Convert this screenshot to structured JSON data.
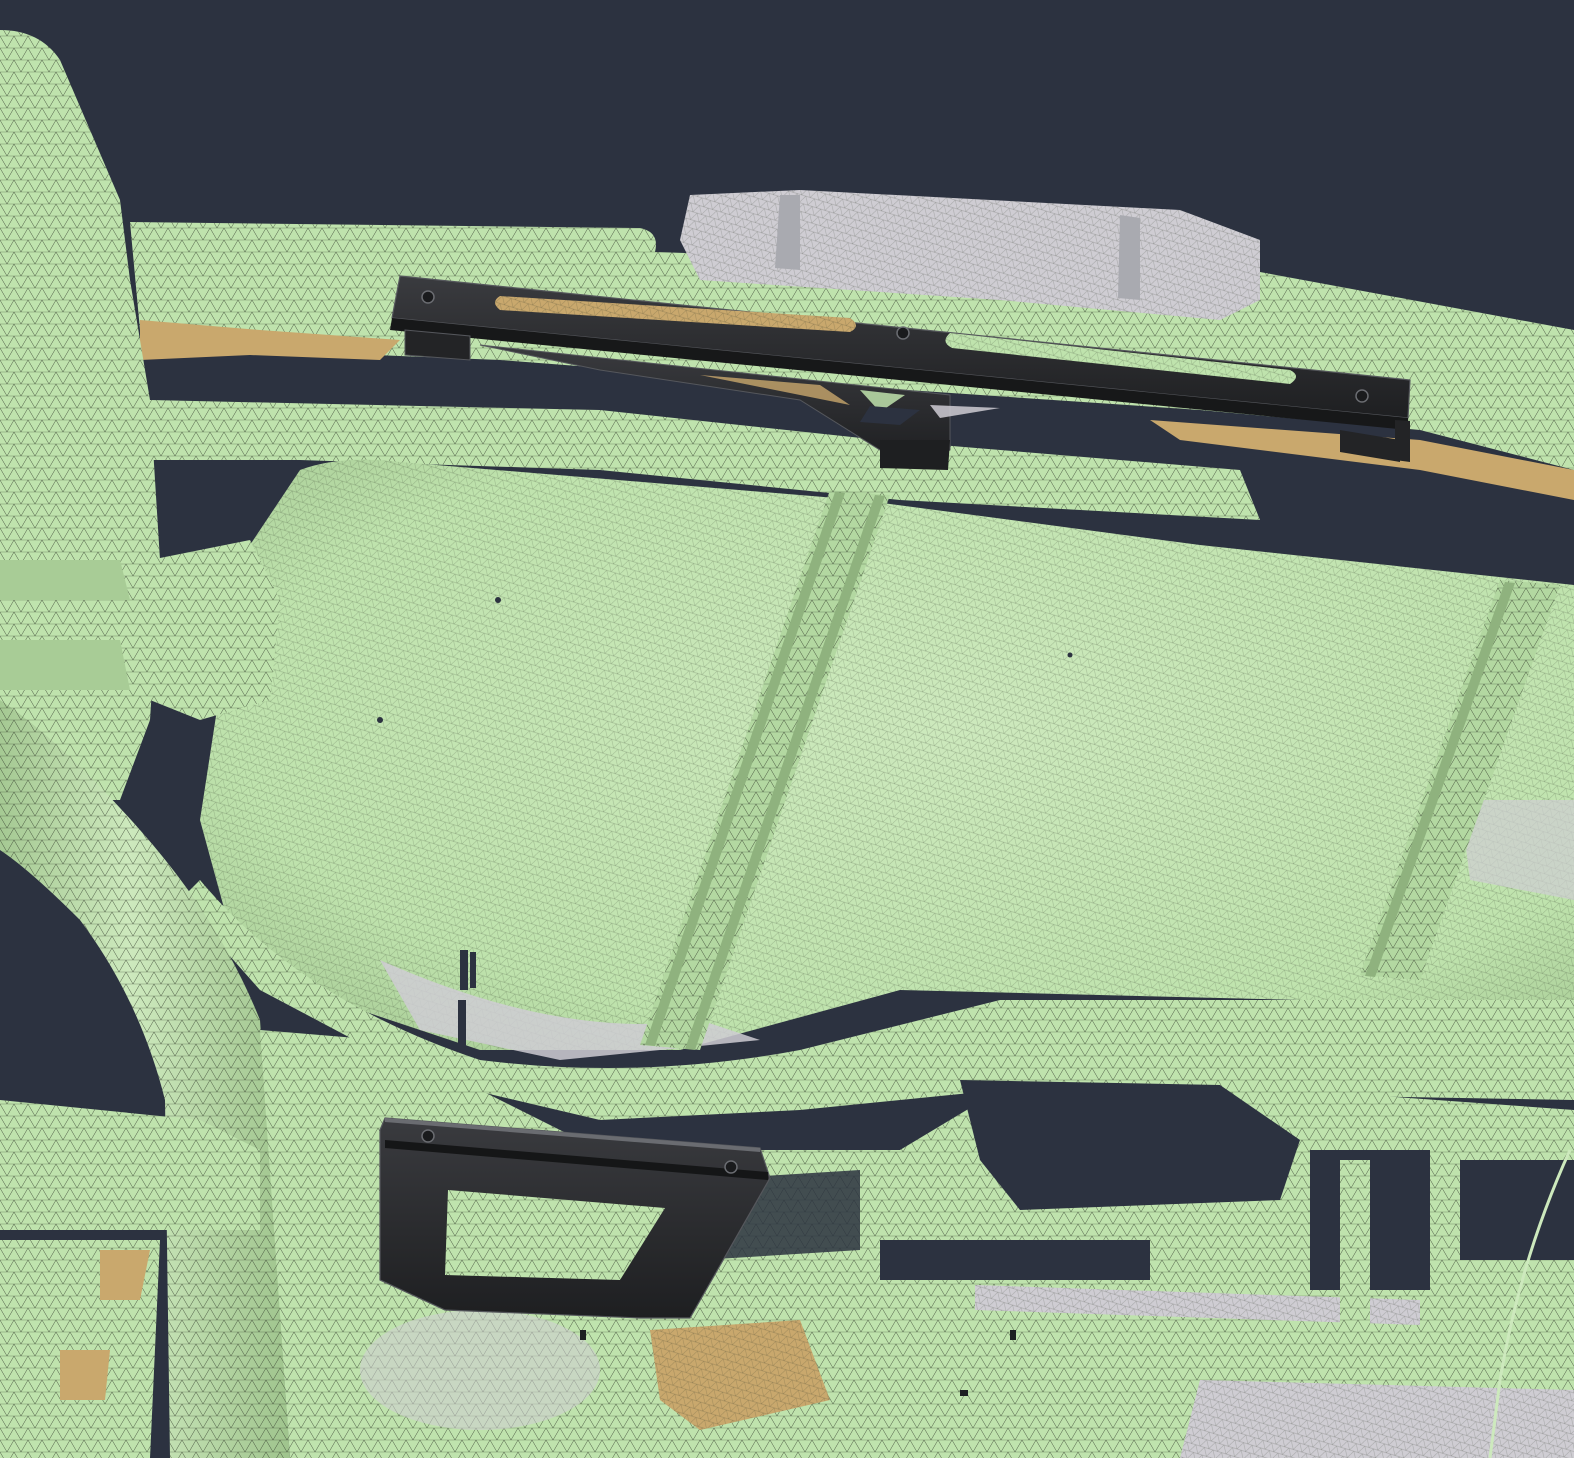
{
  "viewport": {
    "background_color": "#2c3240"
  },
  "colors": {
    "mesh_fill": "#bfe3ad",
    "mesh_fill_light": "#cde9bd",
    "mesh_shadow": "#97bb86",
    "mesh_gray": "#cfcdd3",
    "mesh_tan": "#c9a86d",
    "bracket_fill": "#2a2a2c",
    "bracket_edge": "#55575c",
    "wire": "#2b3324"
  },
  "objects": [
    "scan-mesh-fuel-tank",
    "scan-mesh-frame-rail",
    "scan-mesh-exhaust-pipe",
    "scan-mesh-differential",
    "cad-upper-mounting-bracket",
    "cad-lower-mounting-bracket"
  ]
}
